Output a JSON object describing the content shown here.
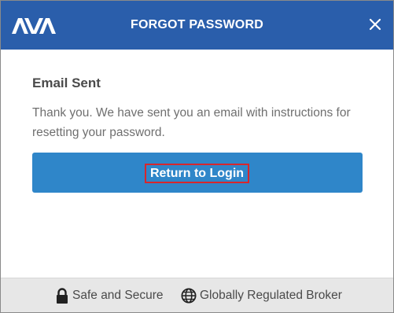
{
  "header": {
    "logo_text": "AVA",
    "title": "FORGOT PASSWORD",
    "close_icon": "close-icon"
  },
  "content": {
    "heading": "Email Sent",
    "message": "Thank you. We have sent you an email with instructions for resetting your password."
  },
  "actions": {
    "return_label": "Return to Login"
  },
  "footer": {
    "secure_icon": "lock-icon",
    "secure_label": "Safe and Secure",
    "regulated_icon": "globe-icon",
    "regulated_label": "Globally Regulated Broker"
  },
  "colors": {
    "header_bg": "#2a5eab",
    "button_bg": "#2f86c9",
    "highlight_border": "#d8262c",
    "footer_bg": "#e7e7e7"
  }
}
